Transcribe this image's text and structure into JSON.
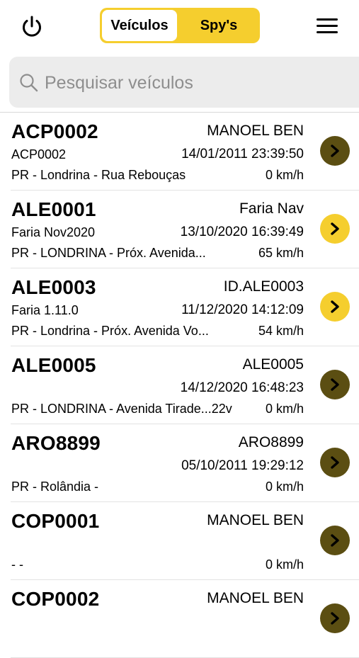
{
  "header": {
    "power_icon": "power-icon",
    "tabs": [
      {
        "label": "Veículos",
        "active": true
      },
      {
        "label": "Spy's",
        "active": false
      }
    ],
    "menu_icon": "hamburger-menu-icon",
    "accent_color": "#f5ce2e"
  },
  "search": {
    "placeholder": "Pesquisar veículos",
    "value": ""
  },
  "vehicles": [
    {
      "plate": "ACP0002",
      "name": "MANOEL BEN",
      "sub": "ACP0002",
      "datetime": "14/01/2011 23:39:50",
      "location": "PR - Londrina - Rua Rebouças",
      "speed": "0 km/h",
      "status_color": "#5b4e12"
    },
    {
      "plate": "ALE0001",
      "name": "Faria Nav",
      "sub": "Faria Nov2020",
      "datetime": "13/10/2020 16:39:49",
      "location": "PR - LONDRINA - Próx. Avenida...",
      "speed": "65 km/h",
      "status_color": "#f5ce2e"
    },
    {
      "plate": "ALE0003",
      "name": "ID.ALE0003",
      "sub": "Faria 1.11.0",
      "datetime": "11/12/2020 14:12:09",
      "location": "PR - Londrina - Próx. Avenida Vo...",
      "speed": "54 km/h",
      "status_color": "#f5ce2e"
    },
    {
      "plate": "ALE0005",
      "name": "ALE0005",
      "sub": "",
      "datetime": "14/12/2020 16:48:23",
      "location": "PR - LONDRINA - Avenida Tirade...22v",
      "speed": "0 km/h",
      "status_color": "#5b4e12"
    },
    {
      "plate": "ARO8899",
      "name": "ARO8899",
      "sub": "",
      "datetime": "05/10/2011 19:29:12",
      "location": "PR - Rolândia -",
      "speed": "0 km/h",
      "status_color": "#5b4e12"
    },
    {
      "plate": "COP0001",
      "name": "MANOEL BEN",
      "sub": "",
      "datetime": "",
      "location": "- -",
      "speed": "0 km/h",
      "status_color": "#5b4e12"
    },
    {
      "plate": "COP0002",
      "name": "MANOEL BEN",
      "sub": "",
      "datetime": "",
      "location": "",
      "speed": "",
      "status_color": "#5b4e12"
    }
  ]
}
